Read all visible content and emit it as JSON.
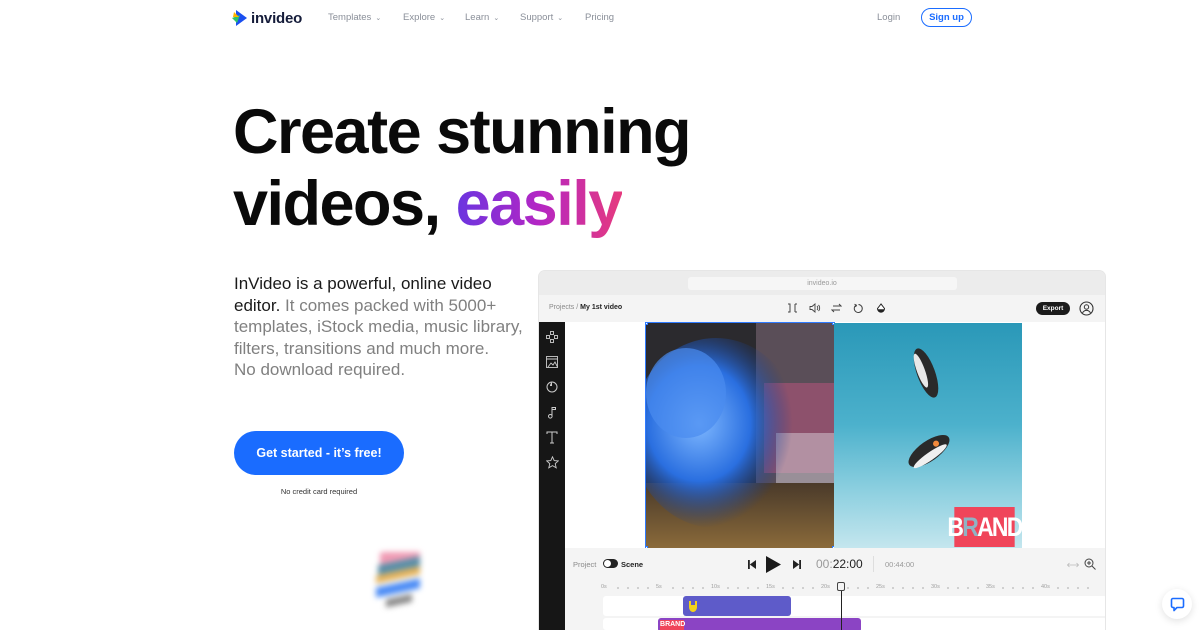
{
  "nav": {
    "brand": "invideo",
    "items": [
      {
        "label": "Templates",
        "has_dropdown": true
      },
      {
        "label": "Explore",
        "has_dropdown": true
      },
      {
        "label": "Learn",
        "has_dropdown": true
      },
      {
        "label": "Support",
        "has_dropdown": true
      },
      {
        "label": "Pricing",
        "has_dropdown": false
      }
    ],
    "chevron": "⌄",
    "login": "Login",
    "signup": "Sign up"
  },
  "hero": {
    "title_line1": "Create stunning",
    "title_line2_plain": "videos, ",
    "title_line2_accent": "easily",
    "desc_strong": "InVideo is a powerful, online video editor.",
    "desc_rest": " It comes packed with 5000+ templates, iStock media, music library, filters, transitions and much more.",
    "desc_last": "No download required.",
    "cta": "Get started - it’s free!",
    "cta_note": "No credit card required"
  },
  "editor": {
    "url": "invideo.io",
    "breadcrumb_root": "Projects",
    "breadcrumb_sep": "/",
    "breadcrumb_current": "My 1st video",
    "toolbar_icons": [
      "split-icon",
      "volume-icon",
      "swap-icon",
      "rotate-icon",
      "opacity-icon"
    ],
    "export": "Export",
    "rail_icons": [
      "layout-icon",
      "media-icon",
      "sticker-icon",
      "music-icon",
      "text-icon",
      "star-icon"
    ],
    "brand_overlay_left": "B",
    "brand_overlay_mid": "R",
    "brand_overlay_right": "AND",
    "toggle_left": "Project",
    "toggle_right": "Scene",
    "time_current_dim": "00:",
    "time_current": "22:00",
    "time_total": "00:44:00",
    "ruler_labels": [
      "0s",
      "5s",
      "10s",
      "15s",
      "20s",
      "25s",
      "30s",
      "35s",
      "40s"
    ],
    "playhead_seconds": 22,
    "timeline_seconds": 44,
    "colors": {
      "accent": "#1a6cff",
      "track_sticker": "#5e5bc9",
      "track_brand": "#8b44c4",
      "brand_red": "#f0455a"
    }
  }
}
